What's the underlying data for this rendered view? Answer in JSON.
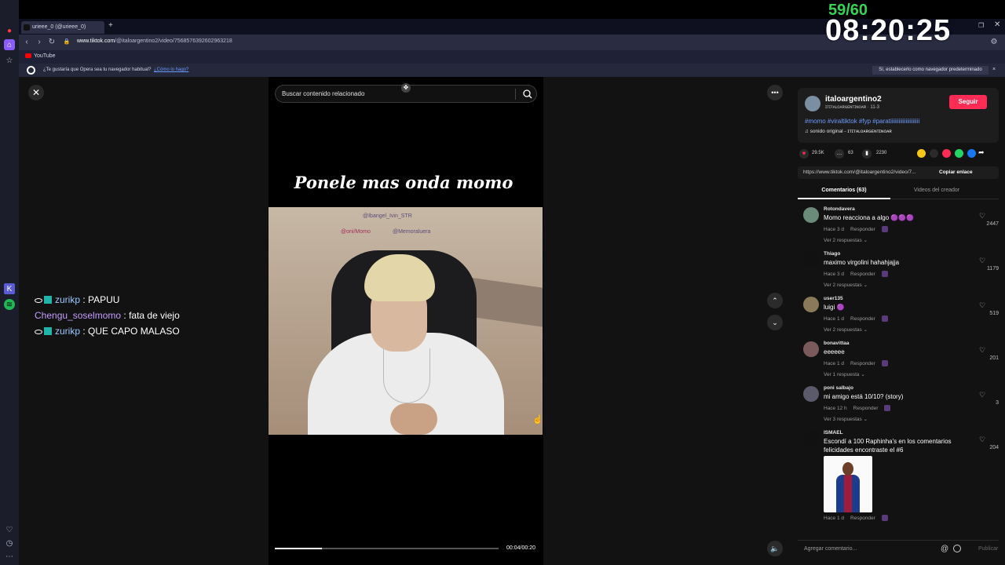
{
  "overlay": {
    "counter": "59/60",
    "time": "08:20:25"
  },
  "browser": {
    "tab_title": "urieee_0 (@urieee_0)",
    "url_domain": "www.tiktok.com",
    "url_path": "/@italoargentino2/video/7568576392602963218",
    "bookmark_youtube": "YouTube",
    "notice_text": "¿Te gustaría que Opera sea tu navegador habitual?",
    "notice_link": "¿Cómo lo hago?",
    "notice_button": "Sí, establecerlo como navegador predeterminado",
    "notice_close": "×"
  },
  "chat": [
    {
      "user": "zurikp",
      "message": " : PAPUU"
    },
    {
      "user": "Chengu_soselmomo",
      "message": " : fata de viejo"
    },
    {
      "user": "zurikp",
      "message": " : QUE CAPO MALASO"
    }
  ],
  "video": {
    "search_placeholder": "Buscar contenido relacionado",
    "caption": "Ponele mas onda momo",
    "room_text_1": "@Ibangel_Ivin_STR",
    "room_text_2": "@oni/Momo",
    "room_text_3": "@Memoraluera",
    "progress_fraction": 0.21,
    "time": "00:04/00:20"
  },
  "creator": {
    "name": "italoargentino2",
    "sub": "ɪᴛɪᴛᴀʟᴏᴀʀɢᴇɴᴛɪɴᴏᴀʀ · 11-3",
    "follow": "Seguir",
    "hashtags": "#momo #viraltiktok #fyp #paratiiiiiiiiiiiiiiiiiiiii",
    "sound": "♫  sonido original - ɪᴛɪᴛᴀʟᴏᴀʀɢᴇɴᴛɪɴᴏᴀʀ"
  },
  "stats": {
    "likes": "29.5K",
    "comments": "63",
    "saves": "2230"
  },
  "link": {
    "url": "https://www.tiktok.com/@italoargentino2/video/7...",
    "copy": "Copiar enlace"
  },
  "tabs": {
    "comments": "Comentarios (63)",
    "creator_videos": "Videos del creador"
  },
  "comments": [
    {
      "user": "Rotondavera",
      "text": "Momo reacciona a algo 🟣🟣🟣",
      "time": "Hace 3 d",
      "reply": "Responder",
      "replies": "Ver 2 respuestas ⌄",
      "likes": "2447"
    },
    {
      "user": "Thiago",
      "text": "maximo virgolini hahahjajja",
      "time": "Hace 3 d",
      "reply": "Responder",
      "replies": "Ver 2 respuestas ⌄",
      "likes": "1179"
    },
    {
      "user": "user135",
      "text": "luigi 🟣",
      "time": "Hace 1 d",
      "reply": "Responder",
      "replies": "Ver 2 respuestas ⌄",
      "likes": "519"
    },
    {
      "user": "bonavittaa",
      "text": "eeeeee",
      "time": "Hace 1 d",
      "reply": "Responder",
      "replies": "Ver 1 respuesta ⌄",
      "likes": "201"
    },
    {
      "user": "poni salbajo",
      "text": "mi amigo está 10/10? (story)",
      "time": "Hace 12 h",
      "reply": "Responder",
      "replies": "Ver 3 respuestas ⌄",
      "likes": "3"
    },
    {
      "user": "ISMAEL",
      "text": "Escondí a 100 Raphinha's en los comentarios",
      "text2": "felicidades encontraste el #6",
      "time": "Hace 1 d",
      "reply": "Responder",
      "likes": "204"
    }
  ],
  "comment_input": {
    "placeholder": "Agregar comentario...",
    "publish": "Publicar"
  }
}
